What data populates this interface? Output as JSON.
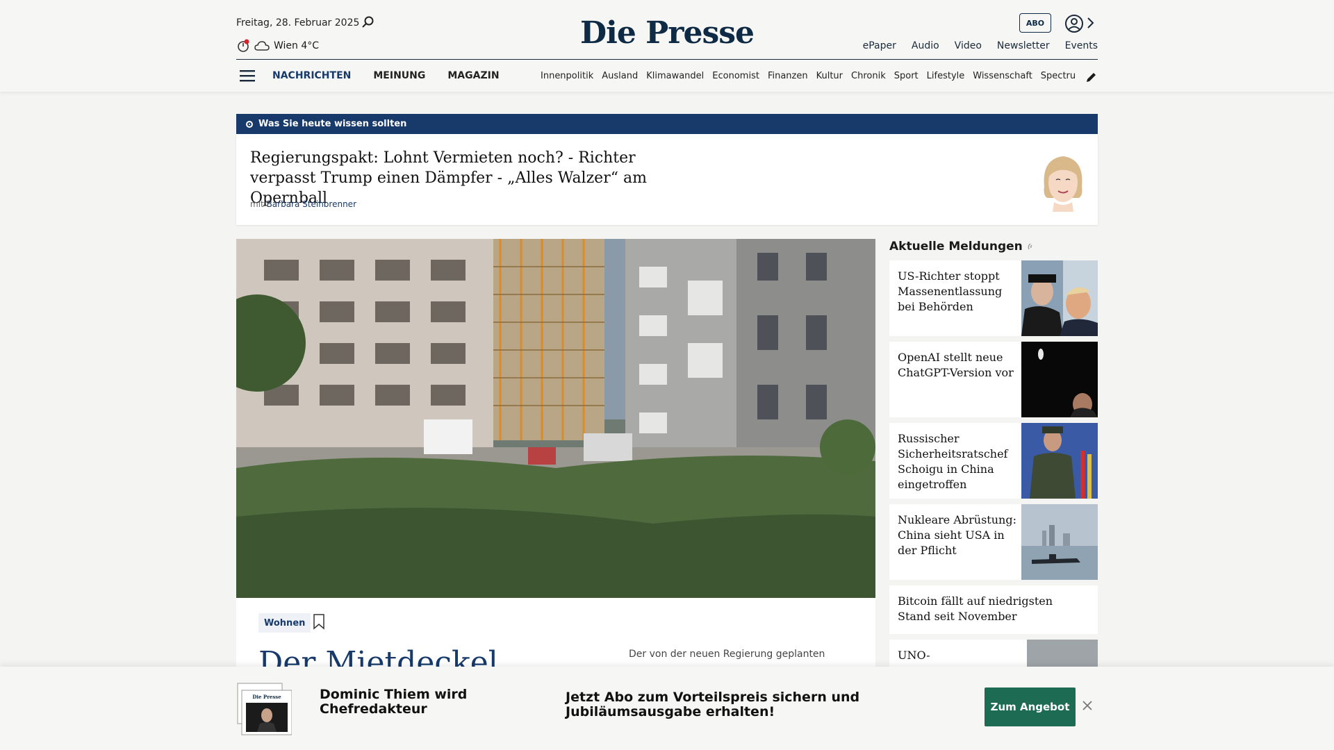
{
  "header": {
    "date": "Freitag, 28. Februar 2025",
    "weather": "Wien 4°C",
    "logo": "Die Presse",
    "abo": "ABO",
    "top_links": [
      "ePaper",
      "Audio",
      "Video",
      "Newsletter",
      "Events"
    ],
    "main_nav": [
      "NACHRICHTEN",
      "MEINUNG",
      "MAGAZIN"
    ],
    "sub_nav": [
      "Innenpolitik",
      "Ausland",
      "Klimawandel",
      "Economist",
      "Finanzen",
      "Kultur",
      "Chronik",
      "Sport",
      "Lifestyle",
      "Wissenschaft",
      "Spectrum"
    ]
  },
  "briefing": {
    "label": "Was Sie heute wissen sollten",
    "title": "Regierungspakt: Lohnt Vermieten noch? - Richter verpasst Trump einen Dämpfer - „Alles Walzer“ am Opernball",
    "by_prefix": "mit",
    "author": "Barbara Steinbrenner"
  },
  "article": {
    "tag": "Wohnen",
    "headline": "Der Mietdeckel",
    "teaser": "Der von der neuen Regierung geplanten"
  },
  "sidebar": {
    "heading": "Aktuelle Meldungen",
    "items": [
      {
        "title": "US-Richter stoppt Massenentlassung bei Behörden"
      },
      {
        "title": "OpenAI stellt neue ChatGPT-Version vor"
      },
      {
        "title": "Russischer Sicherheitsratschef Schoigu in China eingetroffen"
      },
      {
        "title": "Nukleare Abrüstung: China sieht USA in der Pflicht"
      },
      {
        "title": "Bitcoin fällt auf niedrigsten Stand seit November"
      },
      {
        "title": "UNO-"
      }
    ]
  },
  "promo": {
    "title": "Dominic Thiem wird Chefredakteur",
    "text": "Jetzt Abo zum Vorteilspreis sichern und Jubiläumsausgabe erhalten!",
    "button": "Zum Angebot",
    "thumb_logo": "Die Presse"
  },
  "colors": {
    "brand": "#173a6b",
    "cta": "#1d6b52",
    "background": "#f4f4f2"
  }
}
